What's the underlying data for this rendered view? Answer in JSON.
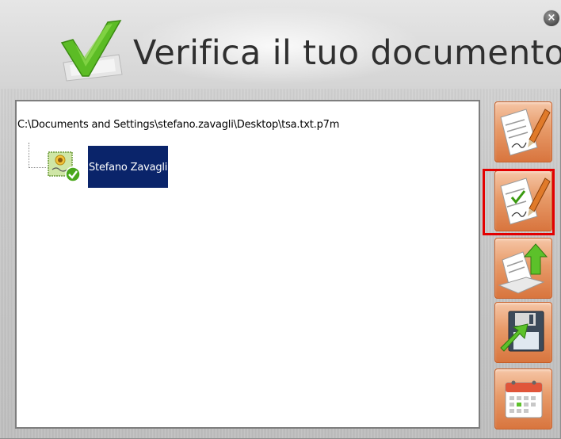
{
  "window": {
    "title": "Verifica il tuo documento",
    "close_icon": "close-icon"
  },
  "tree": {
    "file_path": "C:\\Documents and Settings\\stefano.zavagli\\Desktop\\tsa.txt.p7m",
    "signer_name": "Stefano Zavagli",
    "signer_icon": "certificate-valid-icon"
  },
  "toolbar": {
    "buttons": [
      {
        "icon": "sign-document-icon",
        "selected": false
      },
      {
        "icon": "verify-document-icon",
        "selected": true
      },
      {
        "icon": "extract-document-icon",
        "selected": false
      },
      {
        "icon": "save-document-icon",
        "selected": false
      },
      {
        "icon": "calendar-icon",
        "selected": false
      }
    ]
  },
  "colors": {
    "selection_bg": "#0a246a",
    "button_orange": "#e79a68",
    "highlight_red": "#e30000",
    "logo_green": "#4aa81c"
  }
}
